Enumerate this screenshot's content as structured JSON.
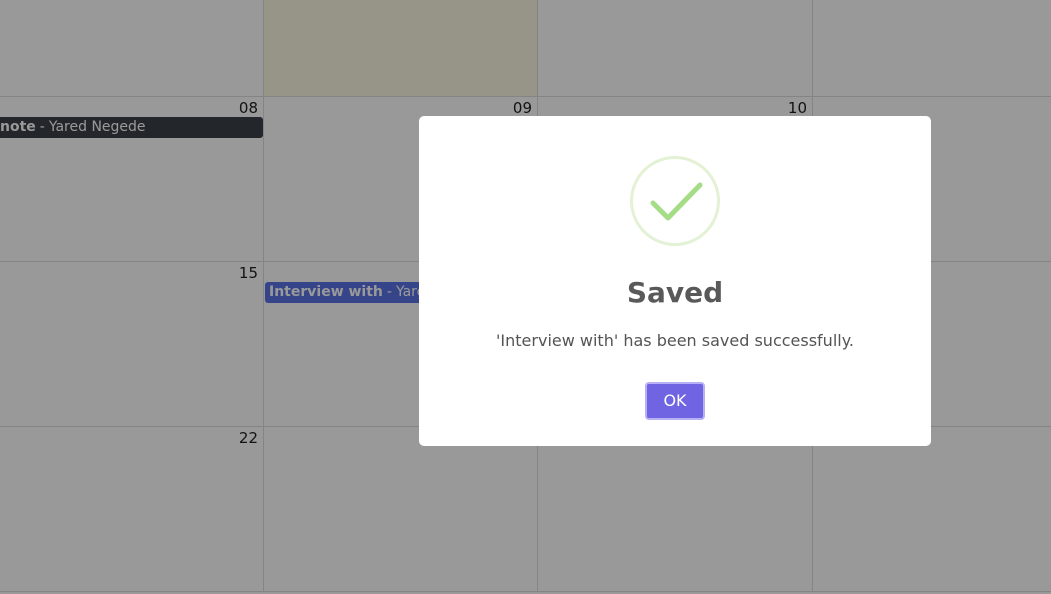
{
  "calendar": {
    "rows": [
      {
        "days": [
          "",
          "",
          "",
          ""
        ]
      },
      {
        "days": [
          "08",
          "09",
          "10",
          ""
        ]
      },
      {
        "days": [
          "15",
          "",
          "",
          ""
        ]
      },
      {
        "days": [
          "22",
          "",
          "",
          ""
        ]
      }
    ],
    "events": [
      {
        "title": "note",
        "separator": "-",
        "person": "Yared Negede"
      },
      {
        "title": "Interview with",
        "separator": "-",
        "person": "Yared Negede"
      }
    ]
  },
  "dialog": {
    "icon": "success-check-icon",
    "title": "Saved",
    "message": "'Interview with' has been saved successfully.",
    "ok_label": "OK",
    "colors": {
      "confirm_button": "#7064e2",
      "check": "#a5dc86",
      "overlay": "rgba(0,0,0,0.4)"
    }
  }
}
